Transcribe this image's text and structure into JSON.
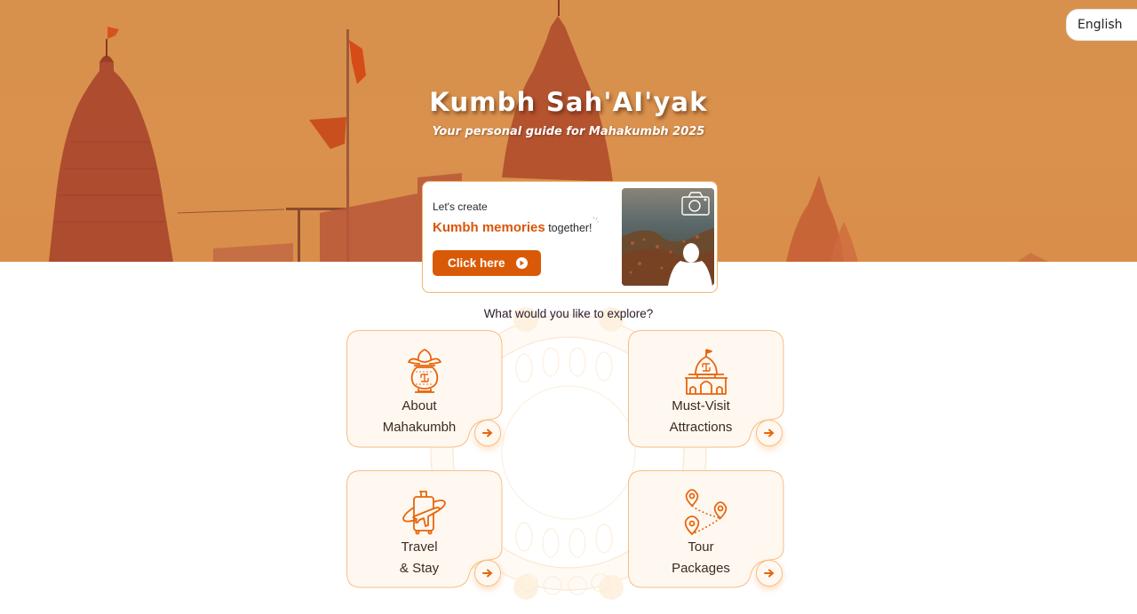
{
  "language_selector": {
    "label": "English"
  },
  "hero": {
    "title": "Kumbh Sah'AI'yak",
    "subtitle": "Your personal guide for Mahakumbh 2025"
  },
  "memories_card": {
    "line1": "Let's create",
    "highlight": "Kumbh memories",
    "line2_rest": "together!",
    "button_label": "Click here"
  },
  "explore": {
    "heading": "What would you like to explore?",
    "tiles": [
      {
        "label_line1": "About",
        "label_line2": "Mahakumbh",
        "icon": "kalash-icon"
      },
      {
        "label_line1": "Must-Visit",
        "label_line2": "Attractions",
        "icon": "temple-icon"
      },
      {
        "label_line1": "Travel",
        "label_line2": "& Stay",
        "icon": "luggage-plane-icon"
      },
      {
        "label_line1": "Tour",
        "label_line2": "Packages",
        "icon": "map-route-icon"
      }
    ]
  },
  "colors": {
    "accent": "#d95a06",
    "hero_bg": "#d8914c",
    "tile_bg": "#fff8f0",
    "tile_border": "#f7be84"
  }
}
